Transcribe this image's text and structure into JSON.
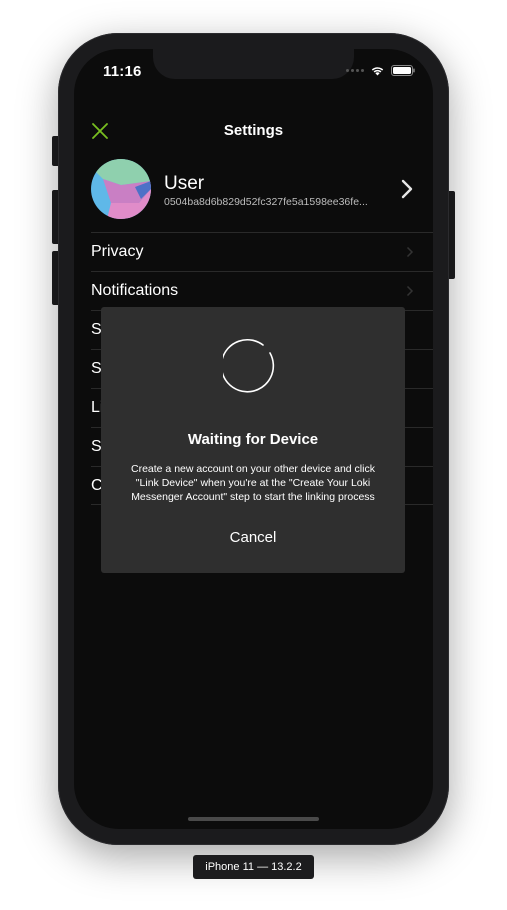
{
  "status_bar": {
    "time": "11:16"
  },
  "nav": {
    "title": "Settings"
  },
  "profile": {
    "name": "User",
    "id": "0504ba8d6b829d52fc327fe5a1598ee36fe..."
  },
  "settings_items": [
    {
      "label": "Privacy"
    },
    {
      "label": "Notifications"
    },
    {
      "label": "S"
    },
    {
      "label": "S"
    },
    {
      "label": "Li"
    },
    {
      "label": "S"
    },
    {
      "label": "C"
    }
  ],
  "modal": {
    "title": "Waiting for Device",
    "message": "Create a new account on your other device and click \"Link Device\" when you're at the \"Create Your Loki Messenger Account\" step to start the linking process",
    "cancel_label": "Cancel"
  },
  "device_label": "iPhone 11 — 13.2.2",
  "icons": {
    "close": "close-icon",
    "chevron": "chevron-right-icon",
    "spinner": "loading-spinner-icon",
    "wifi": "wifi-icon",
    "battery": "battery-icon"
  },
  "colors": {
    "accent": "#78be20",
    "screen_background": "#0c0c0c",
    "modal_background": "#2f2f2f"
  }
}
